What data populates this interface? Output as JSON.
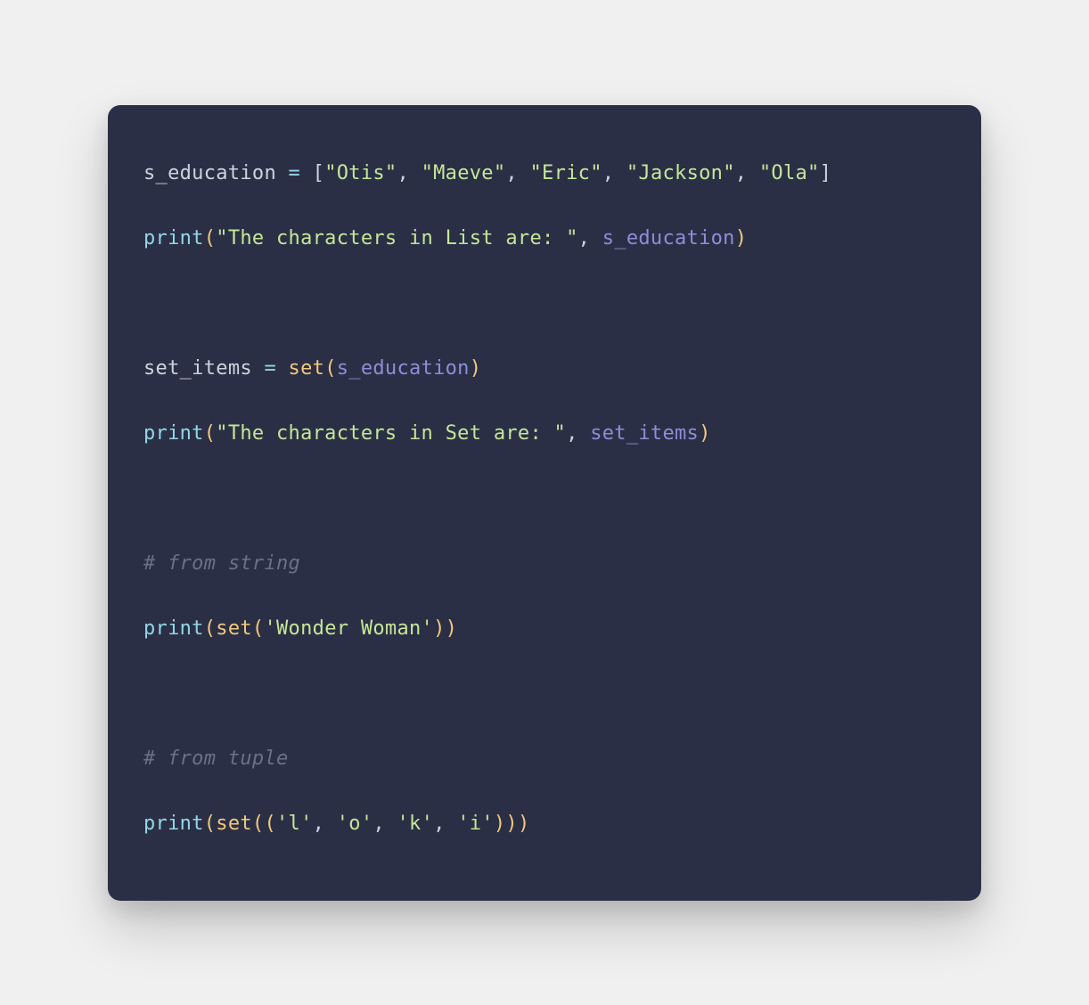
{
  "colors": {
    "background": "#2b2f45",
    "text": "#cdd3de",
    "operator": "#92d7e6",
    "string": "#c5e699",
    "function_print": "#92d7e6",
    "function_set": "#f2c97d",
    "parameter": "#8e8dd8",
    "paren": "#f2c97d",
    "comment": "#6b7089"
  },
  "code": {
    "line1": {
      "var": "s_education",
      "op": " = ",
      "lbracket": "[",
      "s1": "\"Otis\"",
      "c1": ", ",
      "s2": "\"Maeve\"",
      "c2": ", ",
      "s3": "\"Eric\"",
      "c3": ", ",
      "s4": "\"Jackson\"",
      "c4": ", ",
      "s5": "\"Ola\"",
      "rbracket": "]"
    },
    "line2": {
      "func": "print",
      "lparen": "(",
      "s1": "\"The characters in List are: \"",
      "c1": ", ",
      "param": "s_education",
      "rparen": ")"
    },
    "line3": {
      "var": "set_items",
      "op": " = ",
      "func": "set",
      "lparen": "(",
      "param": "s_education",
      "rparen": ")"
    },
    "line4": {
      "func": "print",
      "lparen": "(",
      "s1": "\"The characters in Set are: \"",
      "c1": ", ",
      "param": "set_items",
      "rparen": ")"
    },
    "line5": {
      "comment": "# from string"
    },
    "line6": {
      "func": "print",
      "lparen": "(",
      "func2": "set",
      "lparen2": "(",
      "s1": "'Wonder Woman'",
      "rparen2": ")",
      "rparen": ")"
    },
    "line7": {
      "comment": "# from tuple"
    },
    "line8": {
      "func": "print",
      "lparen": "(",
      "func2": "set",
      "lparen2": "(",
      "lparen3": "(",
      "s1": "'l'",
      "c1": ", ",
      "s2": "'o'",
      "c2": ", ",
      "s3": "'k'",
      "c3": ", ",
      "s4": "'i'",
      "rparen3": ")",
      "rparen2": ")",
      "rparen": ")"
    }
  }
}
